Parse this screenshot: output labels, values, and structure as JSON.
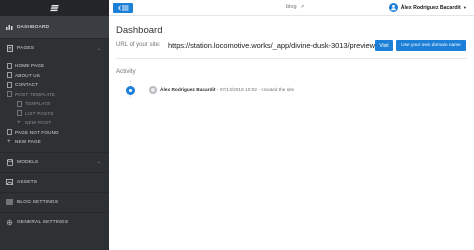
{
  "sidebar": {
    "dashboard_label": "Dashboard",
    "pages_label": "Pages",
    "page_items": [
      {
        "label": "Home page"
      },
      {
        "label": "About us"
      },
      {
        "label": "Contact"
      },
      {
        "label": "Post template"
      },
      {
        "label": "Template"
      },
      {
        "label": "List posts"
      },
      {
        "label": "New post"
      },
      {
        "label": "Page not found"
      },
      {
        "label": "New page"
      }
    ],
    "models_label": "Models",
    "assets_label": "Assets",
    "blog_settings_label": "Blog settings",
    "general_settings_label": "General settings"
  },
  "topbar": {
    "back_icon": "arrow-left-menu-icon",
    "site_name": "blog",
    "external_icon": "external-link-icon",
    "user_name": "Àlex Rodriguez Bacardit",
    "caret": "▾"
  },
  "main": {
    "title": "Dashboard",
    "url_label": "URL of your site:",
    "url_value": "https://station.locomotive.works/_app/divine-dusk-3013/preview",
    "visit_label": "Visit",
    "domain_label": "Use your own domain name",
    "activity_title": "Activity",
    "activity": {
      "user": "Àlex Rodriguez Bacardit",
      "date": "07/13/2016 10:02",
      "separator": "-",
      "action": "created the site"
    }
  },
  "colors": {
    "accent": "#1c7fd8",
    "sidebar_bg": "#2e3134",
    "sidebar_dark": "#232528"
  }
}
